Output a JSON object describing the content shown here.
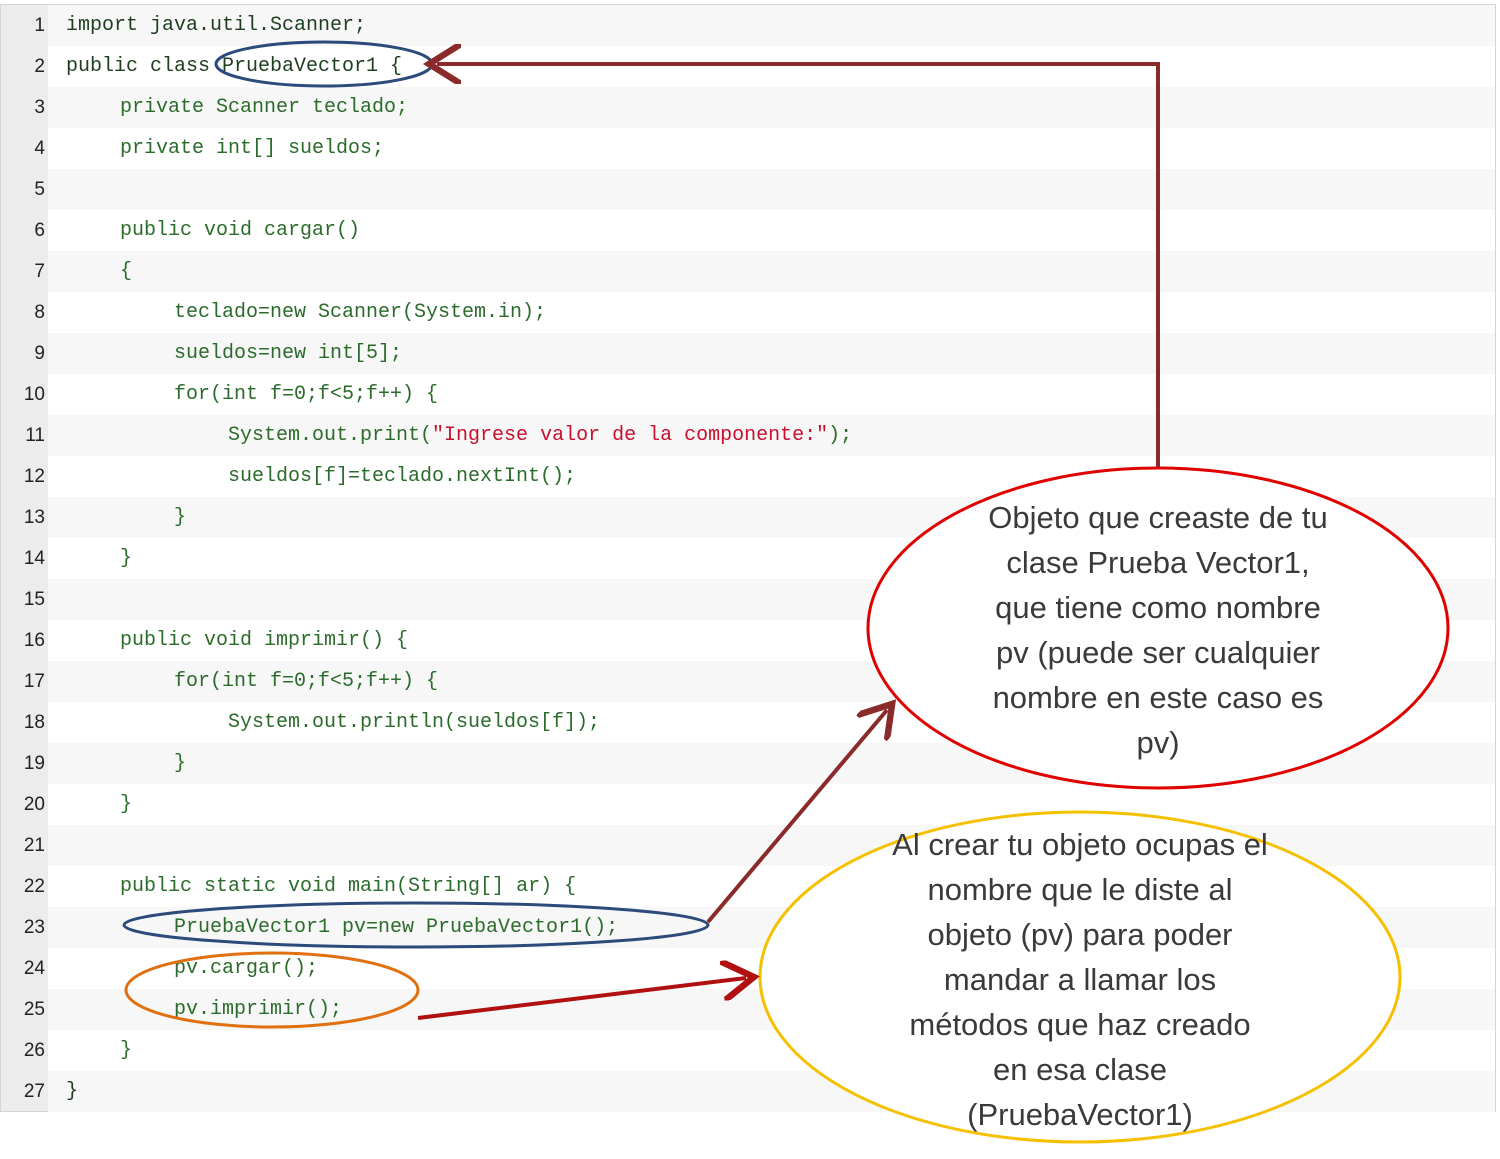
{
  "code_lines": [
    {
      "n": "1",
      "indent": 0,
      "text": "import java.util.Scanner;"
    },
    {
      "n": "2",
      "indent": 0,
      "text": "public class PruebaVector1 {"
    },
    {
      "n": "3",
      "indent": 1,
      "text": "private Scanner teclado;"
    },
    {
      "n": "4",
      "indent": 1,
      "text": "private int[] sueldos;"
    },
    {
      "n": "5",
      "indent": 0,
      "text": ""
    },
    {
      "n": "6",
      "indent": 1,
      "text": "public void cargar()"
    },
    {
      "n": "7",
      "indent": 1,
      "text": "{"
    },
    {
      "n": "8",
      "indent": 2,
      "text": "teclado=new Scanner(System.in);"
    },
    {
      "n": "9",
      "indent": 2,
      "text": "sueldos=new int[5];"
    },
    {
      "n": "10",
      "indent": 2,
      "text": "for(int f=0;f<5;f++) {"
    },
    {
      "n": "11",
      "indent": 3,
      "text": "System.out.print(",
      "string": "\"Ingrese valor de la componente:\"",
      "after": ");"
    },
    {
      "n": "12",
      "indent": 3,
      "text": "sueldos[f]=teclado.nextInt();"
    },
    {
      "n": "13",
      "indent": 2,
      "text": "}"
    },
    {
      "n": "14",
      "indent": 1,
      "text": "}"
    },
    {
      "n": "15",
      "indent": 0,
      "text": ""
    },
    {
      "n": "16",
      "indent": 1,
      "text": "public void imprimir() {"
    },
    {
      "n": "17",
      "indent": 2,
      "text": "for(int f=0;f<5;f++) {"
    },
    {
      "n": "18",
      "indent": 3,
      "text": "System.out.println(sueldos[f]);"
    },
    {
      "n": "19",
      "indent": 2,
      "text": "}"
    },
    {
      "n": "20",
      "indent": 1,
      "text": "}"
    },
    {
      "n": "21",
      "indent": 0,
      "text": ""
    },
    {
      "n": "22",
      "indent": 1,
      "text": "public static void main(String[] ar) {"
    },
    {
      "n": "23",
      "indent": 2,
      "text": "PruebaVector1 pv=new PruebaVector1();"
    },
    {
      "n": "24",
      "indent": 2,
      "text": "pv.cargar();"
    },
    {
      "n": "25",
      "indent": 2,
      "text": "pv.imprimir();"
    },
    {
      "n": "26",
      "indent": 1,
      "text": "}"
    },
    {
      "n": "27",
      "indent": 0,
      "text": "}"
    }
  ],
  "callouts": {
    "object_note": {
      "lines": [
        "Objeto que creaste de tu",
        "clase Prueba Vector1,",
        "que tiene como nombre",
        "pv (puede ser cualquier",
        "nombre en este caso es",
        "pv)"
      ]
    },
    "method_note": {
      "lines": [
        "Al crear tu objeto ocupas el",
        "nombre que le diste al",
        "objeto (pv) para poder",
        "mandar a llamar los",
        "métodos que haz creado",
        "en esa clase",
        "(PruebaVector1)"
      ]
    }
  },
  "colors": {
    "code_text": "#2b6b2b",
    "string_literal": "#c8102e",
    "ellipse_red": "#e00000",
    "ellipse_yellow": "#f5c000",
    "circle_blue": "#2c4a7a",
    "circle_orange": "#e07010",
    "arrow_dark_red": "#8b2a2a"
  }
}
